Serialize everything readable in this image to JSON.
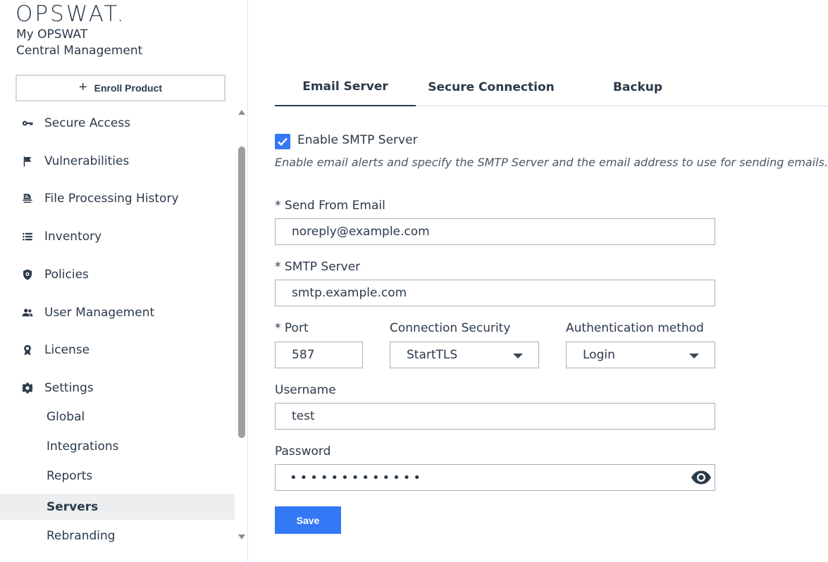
{
  "brand": {
    "logo_text": "OPSWAT.",
    "line1": "My OPSWAT",
    "line2": "Central Management"
  },
  "sidebar": {
    "enroll_label": "Enroll Product",
    "items": [
      {
        "label": "Secure Access",
        "icon": "key-icon"
      },
      {
        "label": "Vulnerabilities",
        "icon": "flag-icon"
      },
      {
        "label": "File Processing History",
        "icon": "file-history-icon"
      },
      {
        "label": "Inventory",
        "icon": "list-icon"
      },
      {
        "label": "Policies",
        "icon": "shield-icon"
      },
      {
        "label": "User Management",
        "icon": "users-icon"
      },
      {
        "label": "License",
        "icon": "badge-icon"
      },
      {
        "label": "Settings",
        "icon": "gear-icon"
      }
    ],
    "settings_sub": [
      "Global",
      "Integrations",
      "Reports",
      "Servers",
      "Rebranding"
    ],
    "active_sub": "Servers"
  },
  "tabs": [
    {
      "label": "Email Server",
      "active": true
    },
    {
      "label": "Secure Connection",
      "active": false
    },
    {
      "label": "Backup",
      "active": false
    }
  ],
  "form": {
    "enable_smtp_label": "Enable SMTP Server",
    "enable_smtp_checked": true,
    "description": "Enable email alerts and specify the SMTP Server and the email address to use for sending emails.",
    "send_from_label": "* Send From Email",
    "send_from_value": "noreply@example.com",
    "smtp_server_label": "* SMTP Server",
    "smtp_server_value": "smtp.example.com",
    "port_label": "* Port",
    "port_value": "587",
    "connection_security_label": "Connection Security",
    "connection_security_value": "StartTLS",
    "auth_method_label": "Authentication method",
    "auth_method_value": "Login",
    "username_label": "Username",
    "username_value": "test",
    "password_label": "Password",
    "password_mask": "•••••••••••••",
    "save_label": "Save"
  },
  "colors": {
    "accent": "#3478f6",
    "text": "#2b3a4a",
    "active_row": "#eceef0"
  }
}
